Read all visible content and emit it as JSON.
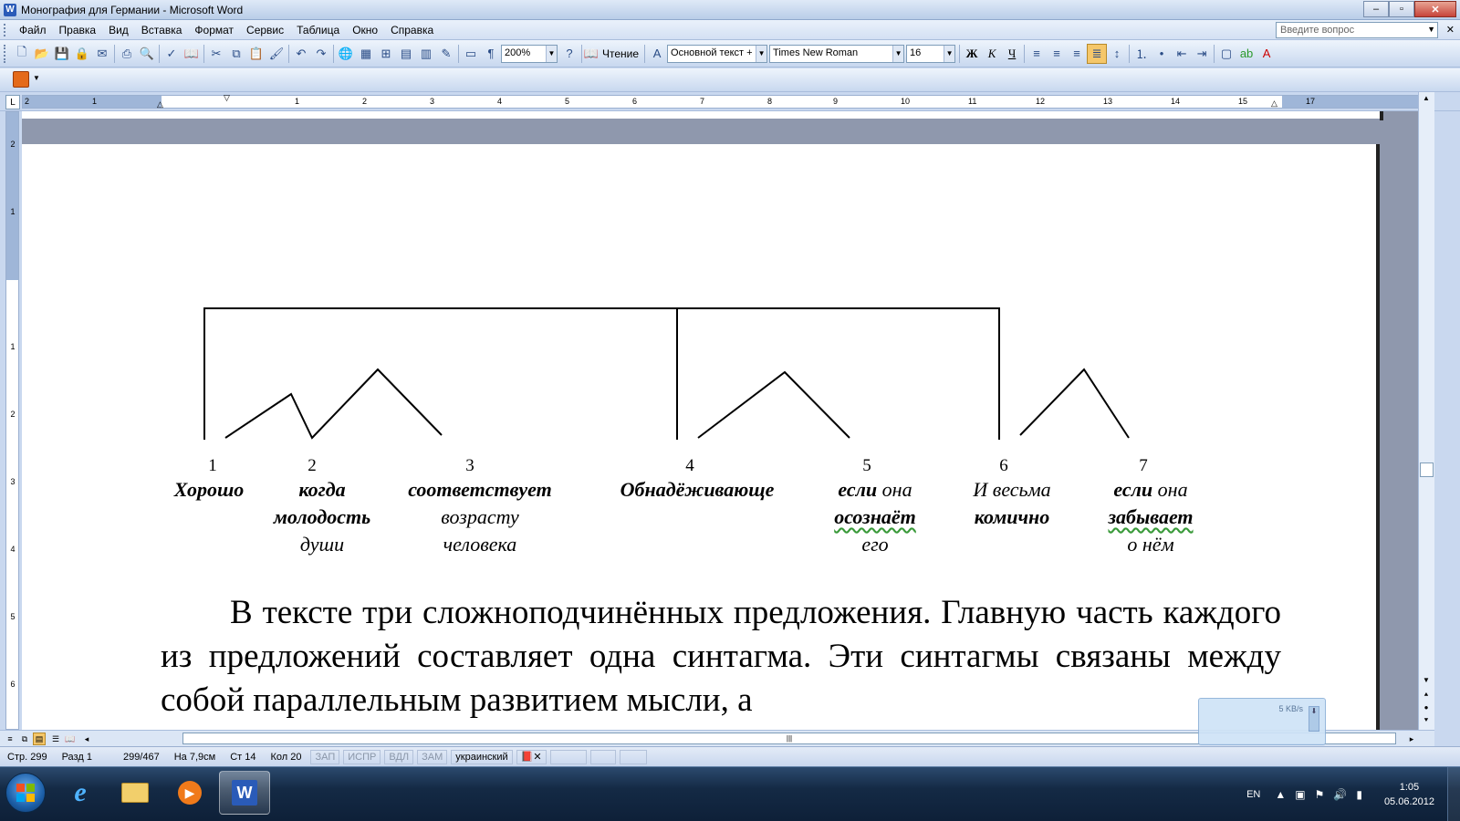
{
  "window": {
    "title": "Монография для Германии - Microsoft Word",
    "minimize": "–",
    "maximize": "▫",
    "close": "✕"
  },
  "menu": {
    "items": [
      {
        "label": "Файл"
      },
      {
        "label": "Правка"
      },
      {
        "label": "Вид"
      },
      {
        "label": "Вставка"
      },
      {
        "label": "Формат"
      },
      {
        "label": "Сервис"
      },
      {
        "label": "Таблица"
      },
      {
        "label": "Окно"
      },
      {
        "label": "Справка"
      }
    ],
    "ask_placeholder": "Введите вопрос"
  },
  "toolbar": {
    "zoom": "200%",
    "reading_label": "Чтение",
    "style": "Основной текст +",
    "font": "Times New Roman",
    "font_size": "16",
    "bold_label": "Ж",
    "italic_label": "К",
    "underline_label": "Ч"
  },
  "ruler": {
    "numbers": [
      "2",
      "1",
      "1",
      "2",
      "3",
      "4",
      "5",
      "6",
      "7",
      "8",
      "9",
      "10",
      "11",
      "12",
      "13",
      "14",
      "15",
      "17"
    ],
    "v_numbers": [
      "2",
      "1",
      "1",
      "2",
      "3",
      "4",
      "5",
      "6"
    ]
  },
  "diagram": {
    "numbers": [
      "1",
      "2",
      "3",
      "4",
      "5",
      "6",
      "7"
    ],
    "col1": {
      "line1": "Хорошо"
    },
    "col2": {
      "line1": "когда",
      "line2": "молодость",
      "line3": "души"
    },
    "col3": {
      "line1": "соответствует",
      "line2": "возрасту",
      "line3": "человека"
    },
    "col4": {
      "line1": "Обнадёживающе"
    },
    "col5": {
      "line1_bold": "если",
      "line1_rest": " она",
      "line2": "осознаёт",
      "line3": "его"
    },
    "col6": {
      "line1": "И весьма",
      "line2": "комично"
    },
    "col7": {
      "line1_bold": "если",
      "line1_rest": " она",
      "line2": "забывает",
      "line3": "о нём"
    }
  },
  "body": {
    "text": "В тексте три сложноподчинённых предложения. Главную часть каждого из предложений составляет одна синтагма. Эти синтагмы связаны между собой параллельным развитием мысли, а"
  },
  "popup": {
    "speed": "5 KB/s"
  },
  "status": {
    "page": "Стр. 299",
    "section": "Разд 1",
    "pages": "299/467",
    "at": "На 7,9см",
    "line": "Ст 14",
    "col": "Кол 20",
    "rec": "ЗАП",
    "trk": "ИСПР",
    "ext": "ВДЛ",
    "ovr": "ЗАМ",
    "language": "украинский"
  },
  "taskbar": {
    "lang": "EN",
    "time": "1:05",
    "date": "05.06.2012"
  },
  "colors": {
    "accent": "#2a5bb8",
    "active_button": "#f5c76a",
    "spellcheck_wavy": "#3a9a3a"
  }
}
